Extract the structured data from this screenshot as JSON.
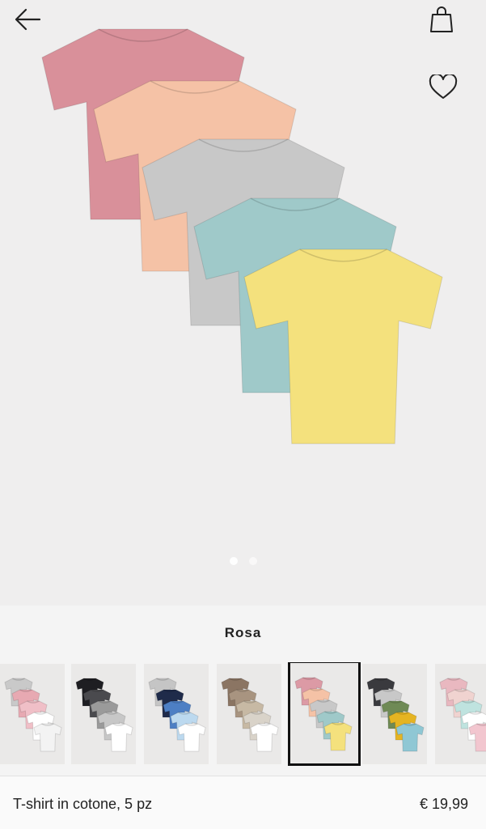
{
  "header": {
    "back_icon": "arrow-left-icon",
    "bag_icon": "shopping-bag-icon",
    "favorite_icon": "heart-icon"
  },
  "gallery": {
    "image_count": 2,
    "active_index": 0,
    "shirt_colors": [
      "#d9909a",
      "#f5c2a6",
      "#c8c8c8",
      "#9fc9c9",
      "#f4e17d"
    ]
  },
  "color": {
    "selected_name": "Rosa"
  },
  "swatches": [
    {
      "colors": [
        "#c9c9c9",
        "#e7a9b2",
        "#f0bfc7",
        "#ffffff",
        "#f3f3f3"
      ],
      "selected": false
    },
    {
      "colors": [
        "#1e1e22",
        "#4a4a4e",
        "#9a9a9a",
        "#c7c7c7",
        "#ffffff"
      ],
      "selected": false
    },
    {
      "colors": [
        "#c5c5c5",
        "#1f2b4a",
        "#4d7fc4",
        "#bcd9ef",
        "#ffffff"
      ],
      "selected": false
    },
    {
      "colors": [
        "#8b7563",
        "#a89480",
        "#c7b9a4",
        "#d9d3c9",
        "#ffffff"
      ],
      "selected": false
    },
    {
      "colors": [
        "#dc9aa5",
        "#f5c2a6",
        "#c8c8c8",
        "#9fc9c9",
        "#f4e17d"
      ],
      "selected": true
    },
    {
      "colors": [
        "#3a3a3e",
        "#c8c8c8",
        "#6f8a55",
        "#e5b422",
        "#8fc7d4"
      ],
      "selected": false
    },
    {
      "colors": [
        "#e9b8c0",
        "#f0d3d0",
        "#bfe3df",
        "#ffffff",
        "#f2c6cf"
      ],
      "selected": false
    }
  ],
  "product": {
    "name": "T-shirt in cotone, 5 pz",
    "price": "€ 19,99"
  }
}
